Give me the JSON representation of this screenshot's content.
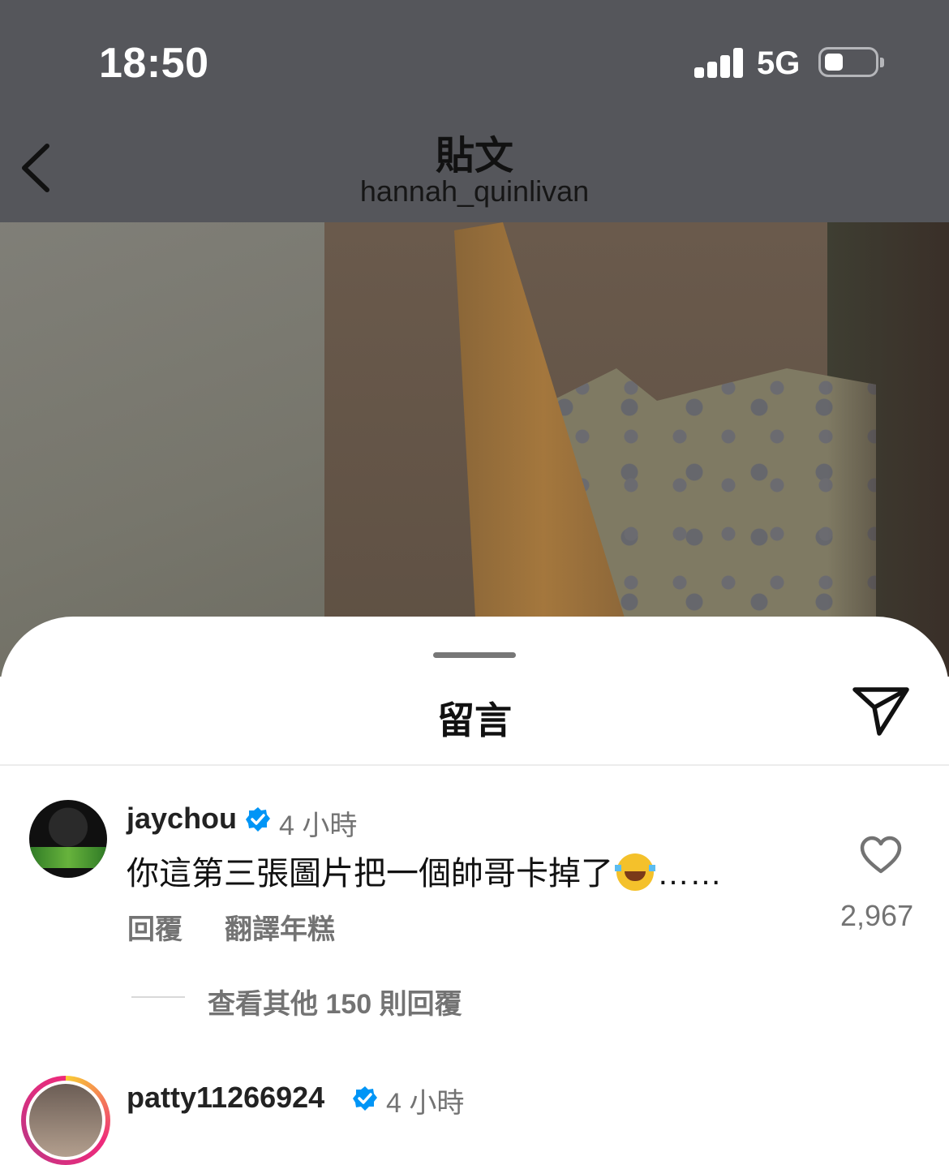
{
  "status_bar": {
    "time": "18:50",
    "network": "5G"
  },
  "header": {
    "title": "貼文",
    "subtitle": "hannah_quinlivan"
  },
  "sheet": {
    "title": "留言"
  },
  "comments": [
    {
      "username": "jaychou",
      "time_ago": "4 小時",
      "text": "你這第三張圖片把一個帥哥卡掉了",
      "text_suffix": "……",
      "emoji": "face-with-tears-of-joy",
      "reply_label": "回覆",
      "translate_label": "翻譯年糕",
      "likes": "2,967",
      "view_replies_label": "查看其他 150 則回覆"
    },
    {
      "username": "patty11266924",
      "time_ago": "4 小時"
    }
  ],
  "colors": {
    "header_bg": "#55565b",
    "verified_blue": "#0095f6",
    "muted_text": "#737373"
  }
}
